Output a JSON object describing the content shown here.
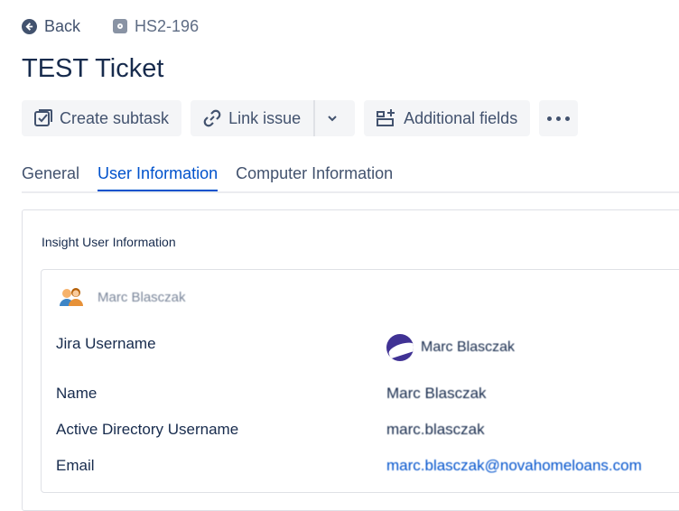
{
  "nav": {
    "back_label": "Back",
    "issue_key": "HS2-196"
  },
  "issue": {
    "title": "TEST Ticket"
  },
  "toolbar": {
    "create_subtask": "Create subtask",
    "link_issue": "Link issue",
    "additional_fields": "Additional fields"
  },
  "tabs": [
    {
      "label": "General",
      "active": false
    },
    {
      "label": "User Information",
      "active": true
    },
    {
      "label": "Computer Information",
      "active": false
    }
  ],
  "panel": {
    "title": "Insight User Information",
    "object_name": "Marc Blasczak",
    "fields": [
      {
        "label": "Jira Username",
        "value": "Marc Blasczak"
      },
      {
        "label": "Name",
        "value": "Marc Blasczak"
      },
      {
        "label": "Active Directory Username",
        "value": "marc.blasczak"
      },
      {
        "label": "Email",
        "value": "marc.blasczak@novahomeloans.com"
      }
    ]
  },
  "colors": {
    "accent": "#0052cc",
    "text": "#172b4d",
    "button_bg": "#f4f5f7",
    "avatar": "#403294"
  },
  "icons": [
    "arrow-left-icon",
    "issue-type-icon",
    "subtask-icon",
    "link-icon",
    "chevron-down-icon",
    "add-fields-icon",
    "more-icon",
    "people-icon"
  ]
}
